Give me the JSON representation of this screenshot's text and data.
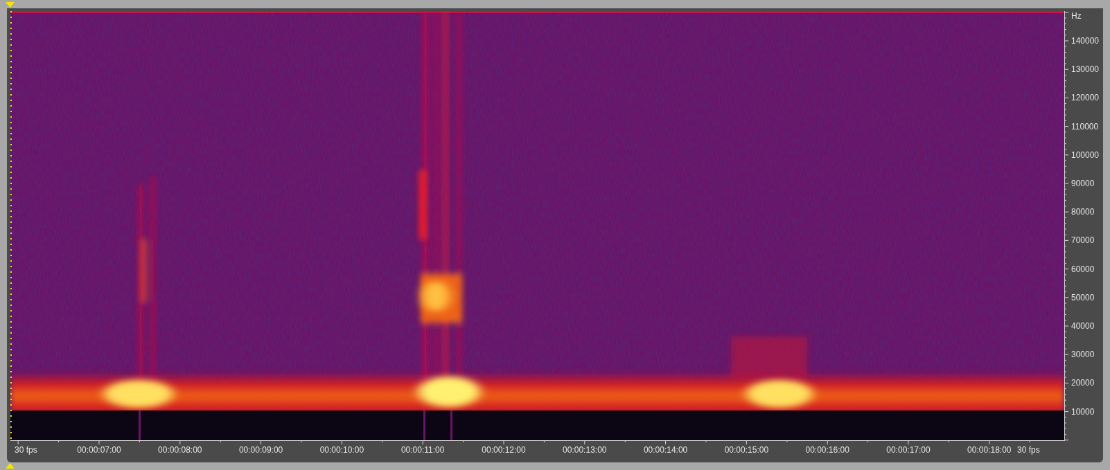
{
  "frequency_axis": {
    "unit": "Hz",
    "ticks": [
      "140000",
      "130000",
      "120000",
      "110000",
      "100000",
      "90000",
      "80000",
      "70000",
      "60000",
      "50000",
      "40000",
      "30000",
      "20000",
      "10000"
    ]
  },
  "time_axis": {
    "frame_rate_left": "30 fps",
    "ticks": [
      "00:00:07:00",
      "00:00:08:00",
      "00:00:09:00",
      "00:00:10:00",
      "00:00:11:00",
      "00:00:12:00",
      "00:00:13:00",
      "00:00:14:00",
      "00:00:15:00",
      "00:00:16:00",
      "00:00:17:00",
      "00:00:18:00"
    ],
    "frame_rate_right": "30 fps"
  }
}
